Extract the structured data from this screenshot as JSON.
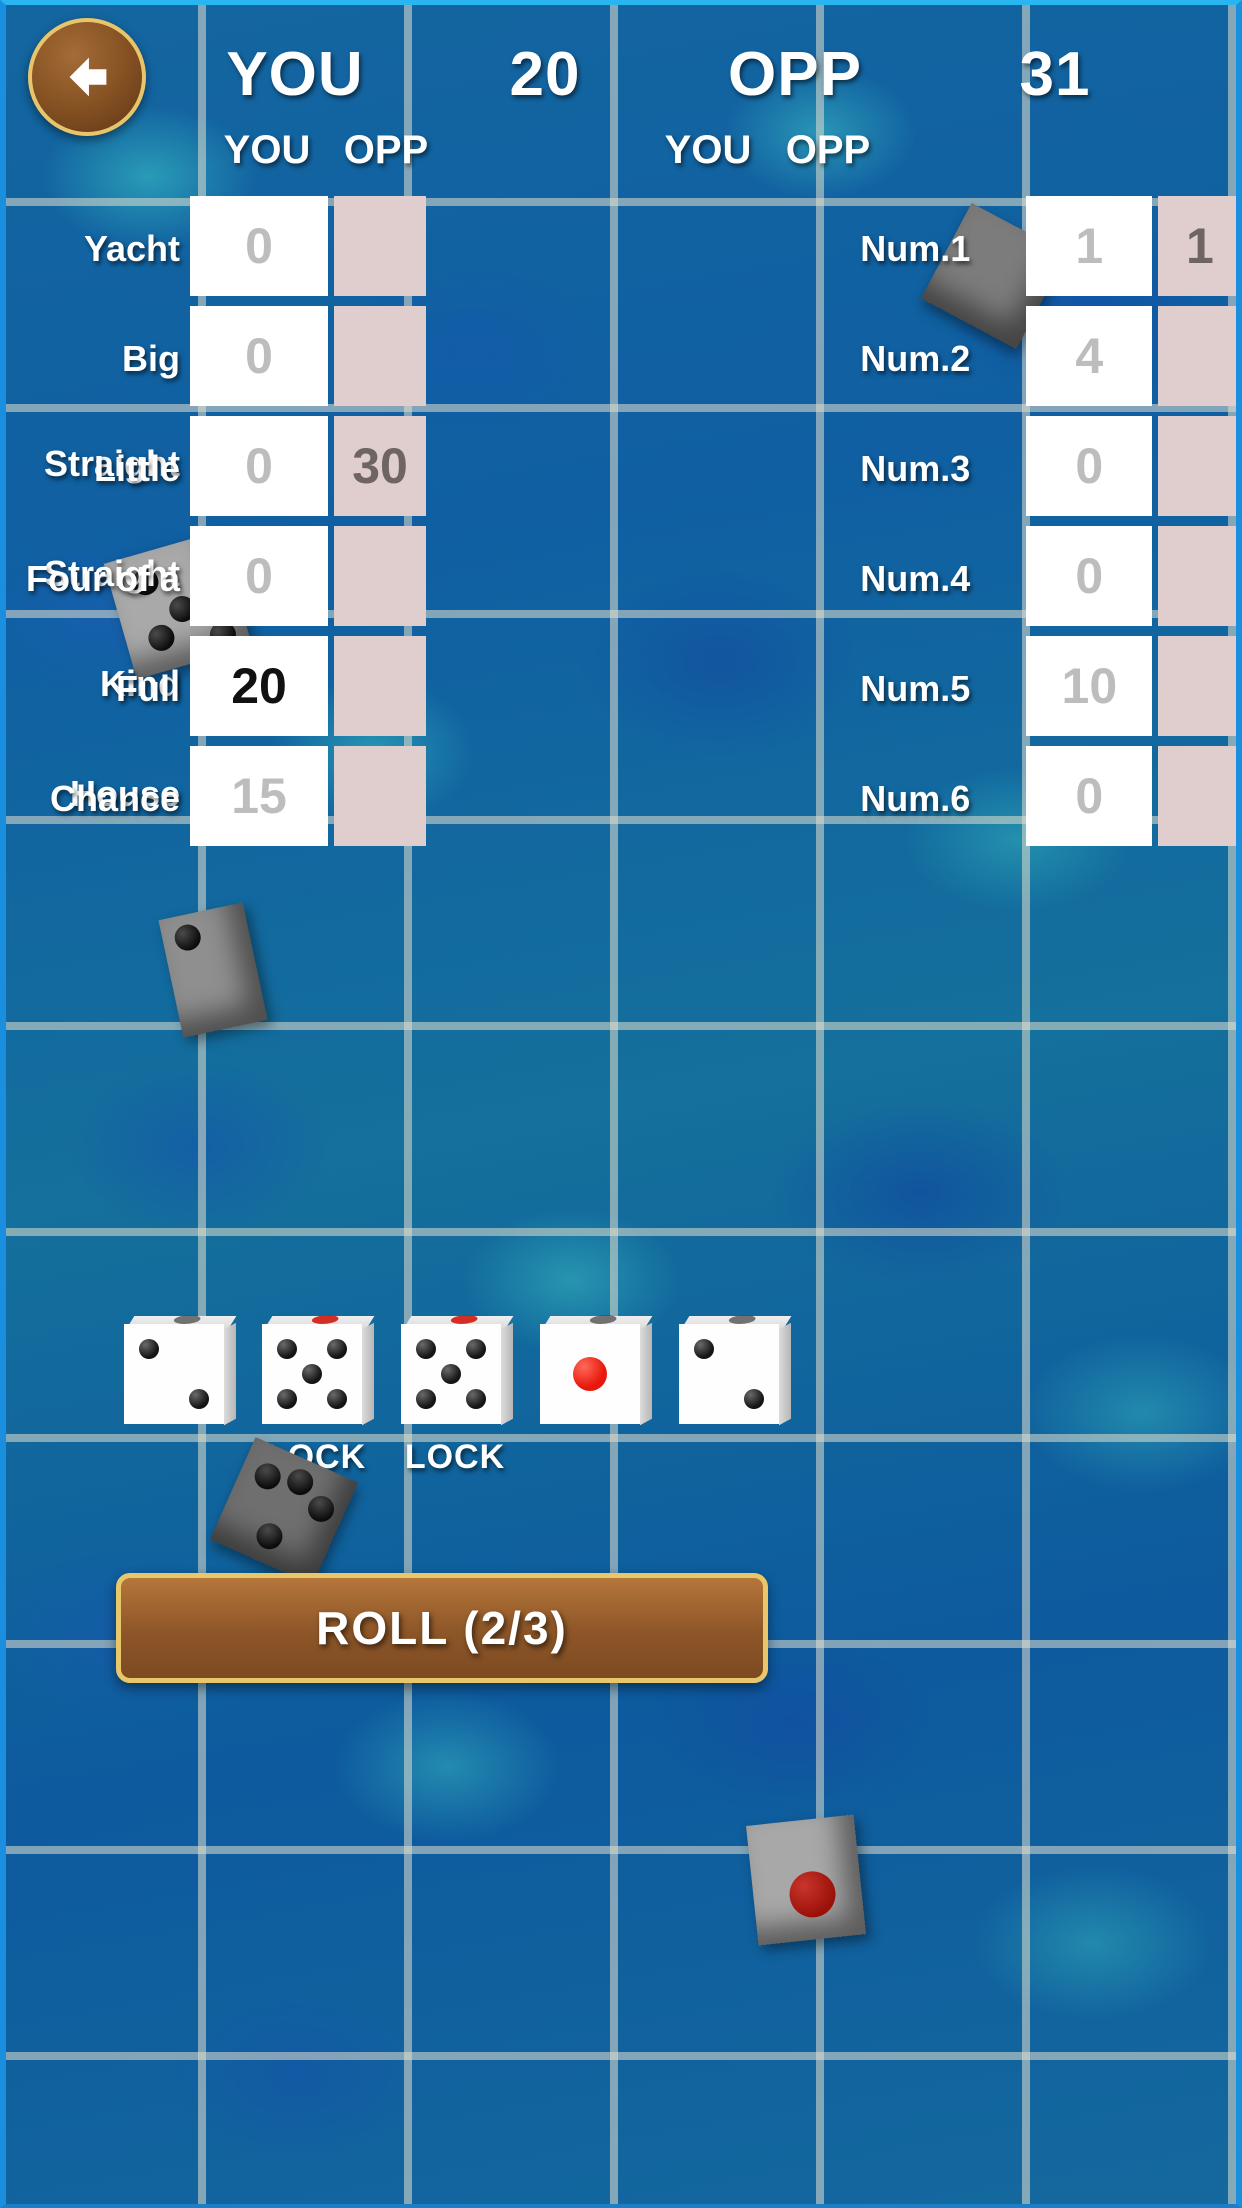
{
  "header": {
    "back_icon": "arrow-left-icon",
    "you_label": "YOU",
    "you_score": "20",
    "opp_label": "OPP",
    "opp_score": "31"
  },
  "columns": {
    "left_you": "YOU",
    "left_opp": "OPP",
    "right_you": "YOU",
    "right_opp": "OPP"
  },
  "scorecard": {
    "left_rows": [
      {
        "label": "Yacht",
        "you": "0",
        "opp": "",
        "you_picked": false
      },
      {
        "label": "Big Straight",
        "you": "0",
        "opp": "",
        "you_picked": false
      },
      {
        "label": "Little Straight",
        "you": "0",
        "opp": "30",
        "you_picked": false
      },
      {
        "label": "Four of a Kind",
        "you": "0",
        "opp": "",
        "you_picked": false
      },
      {
        "label": "Full House",
        "you": "20",
        "opp": "",
        "you_picked": true
      },
      {
        "label": "Chance",
        "you": "15",
        "opp": "",
        "you_picked": false
      }
    ],
    "right_rows": [
      {
        "label": "Num.1",
        "you": "1",
        "opp": "1",
        "you_picked": false
      },
      {
        "label": "Num.2",
        "you": "4",
        "opp": "",
        "you_picked": false
      },
      {
        "label": "Num.3",
        "you": "0",
        "opp": "",
        "you_picked": false
      },
      {
        "label": "Num.4",
        "you": "0",
        "opp": "",
        "you_picked": false
      },
      {
        "label": "Num.5",
        "you": "10",
        "opp": "",
        "you_picked": false
      },
      {
        "label": "Num.6",
        "you": "0",
        "opp": "",
        "you_picked": false
      }
    ]
  },
  "dice": [
    {
      "value": 2,
      "locked": false,
      "lock_label": ""
    },
    {
      "value": 5,
      "locked": true,
      "lock_label": "LOCK"
    },
    {
      "value": 5,
      "locked": true,
      "lock_label": "LOCK"
    },
    {
      "value": 1,
      "locked": false,
      "lock_label": ""
    },
    {
      "value": 2,
      "locked": false,
      "lock_label": ""
    }
  ],
  "roll_button": {
    "label": "ROLL (2/3)",
    "rolls_used": 2,
    "rolls_total": 3
  },
  "colors": {
    "accent_gold": "#e8c76b",
    "button_brown": "#8d5628",
    "opp_cell": "#dfcecd",
    "you_cell": "#ffffff",
    "water_blue": "#106597",
    "picked_text": "#111111",
    "placeholder_text": "#bdbdbd"
  }
}
